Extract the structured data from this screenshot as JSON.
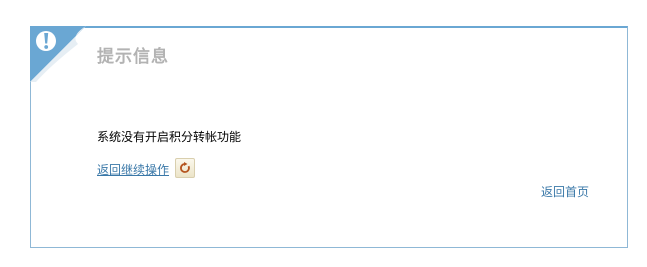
{
  "notice": {
    "title": "提示信息",
    "message": "系统没有开启积分转帐功能",
    "back_label": "返回继续操作",
    "home_label": "返回首页"
  },
  "icons": {
    "alert": "exclamation-icon",
    "refresh": "refresh-icon"
  },
  "colors": {
    "border": "#8fb8d6",
    "corner": "#6aa7d3",
    "title": "#b3b3b3",
    "link": "#3a78a8"
  }
}
